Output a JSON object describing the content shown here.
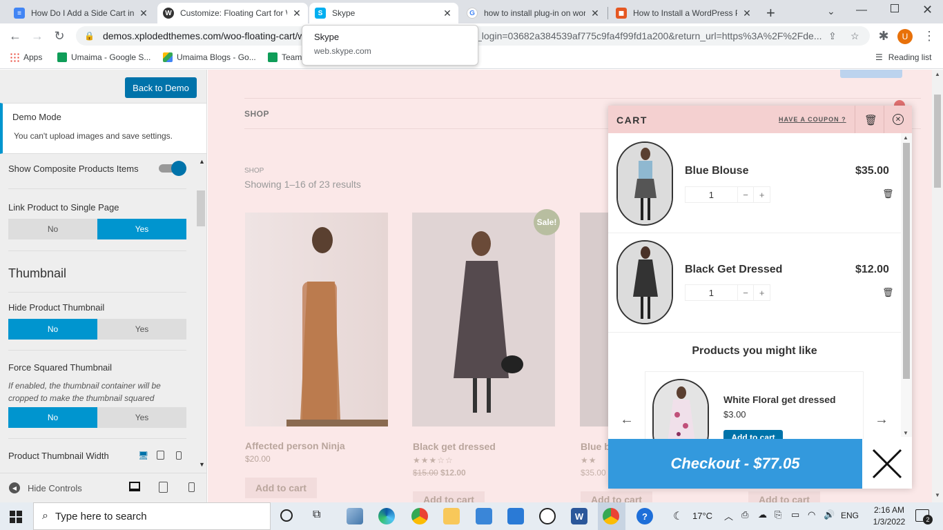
{
  "tabs": [
    {
      "title": "How Do I Add a Side Cart in W",
      "color": "#4285f4"
    },
    {
      "title": "Customize: Floating Cart for W",
      "color": "#333333"
    },
    {
      "title": "Skype",
      "color": "#00aff0"
    },
    {
      "title": "how to install plug-in on wor",
      "color": "#4285f4"
    },
    {
      "title": "How to Install a WordPress P",
      "color": "#e55722"
    }
  ],
  "omnibox": {
    "url": "demos.xplodedthemes.com/woo-floating-cart/w",
    "url_tail": "_login=03682a384539af775c9fa4f99fd1a200&return_url=https%3A%2F%2Fde..."
  },
  "profile_initial": "U",
  "bookmarks": [
    {
      "label": "Apps"
    },
    {
      "label": "Umaima - Google S..."
    },
    {
      "label": "Umaima Blogs - Go..."
    },
    {
      "label": "Team"
    }
  ],
  "reading_list": "Reading list",
  "tooltip": {
    "title": "Skype",
    "url": "web.skype.com"
  },
  "panel": {
    "back_button": "Back to Demo",
    "demo_mode_title": "Demo Mode",
    "demo_mode_text": "You can't upload images and save settings.",
    "show_composite": "Show Composite Products Items",
    "link_product": "Link Product to Single Page",
    "no": "No",
    "yes": "Yes",
    "thumbnail_heading": "Thumbnail",
    "hide_thumbnail": "Hide Product Thumbnail",
    "force_squared": "Force Squared Thumbnail",
    "force_squared_desc": "If enabled, the thumbnail container will be cropped to make the thumbnail squared",
    "thumb_width": "Product Thumbnail Width",
    "hide_controls": "Hide Controls"
  },
  "site": {
    "nav_shop": "SHOP",
    "breadcrumb": "SHOP",
    "results": "Showing 1–16 of 23 results",
    "sale_badge": "Sale!",
    "products": [
      {
        "name": "Affected person Ninja",
        "price": "$20.00",
        "old_price": "",
        "button": "Add to cart"
      },
      {
        "name": "Black get dressed",
        "price": "$12.00",
        "old_price": "$15.00",
        "button": "Add to cart"
      },
      {
        "name": "Blue b",
        "price": "$35.00",
        "old_price": "",
        "button": "Add to cart"
      },
      {
        "name": "",
        "price": "",
        "old_price": "",
        "button": "Add to cart"
      }
    ]
  },
  "cart": {
    "title": "CART",
    "coupon": "HAVE A COUPON ?",
    "items": [
      {
        "name": "Blue Blouse",
        "price": "$35.00",
        "qty": "1"
      },
      {
        "name": "Black Get Dressed",
        "price": "$12.00",
        "qty": "1"
      }
    ],
    "upsell_title": "Products you might like",
    "upsell": {
      "name": "White Floral get dressed",
      "price": "$3.00",
      "button": "Add to cart"
    },
    "checkout": "Checkout - $77.05"
  },
  "taskbar": {
    "search": "Type here to search",
    "weather": "17°C",
    "lang": "ENG",
    "time": "2:16 AM",
    "date": "1/3/2022",
    "notif_count": "2"
  }
}
